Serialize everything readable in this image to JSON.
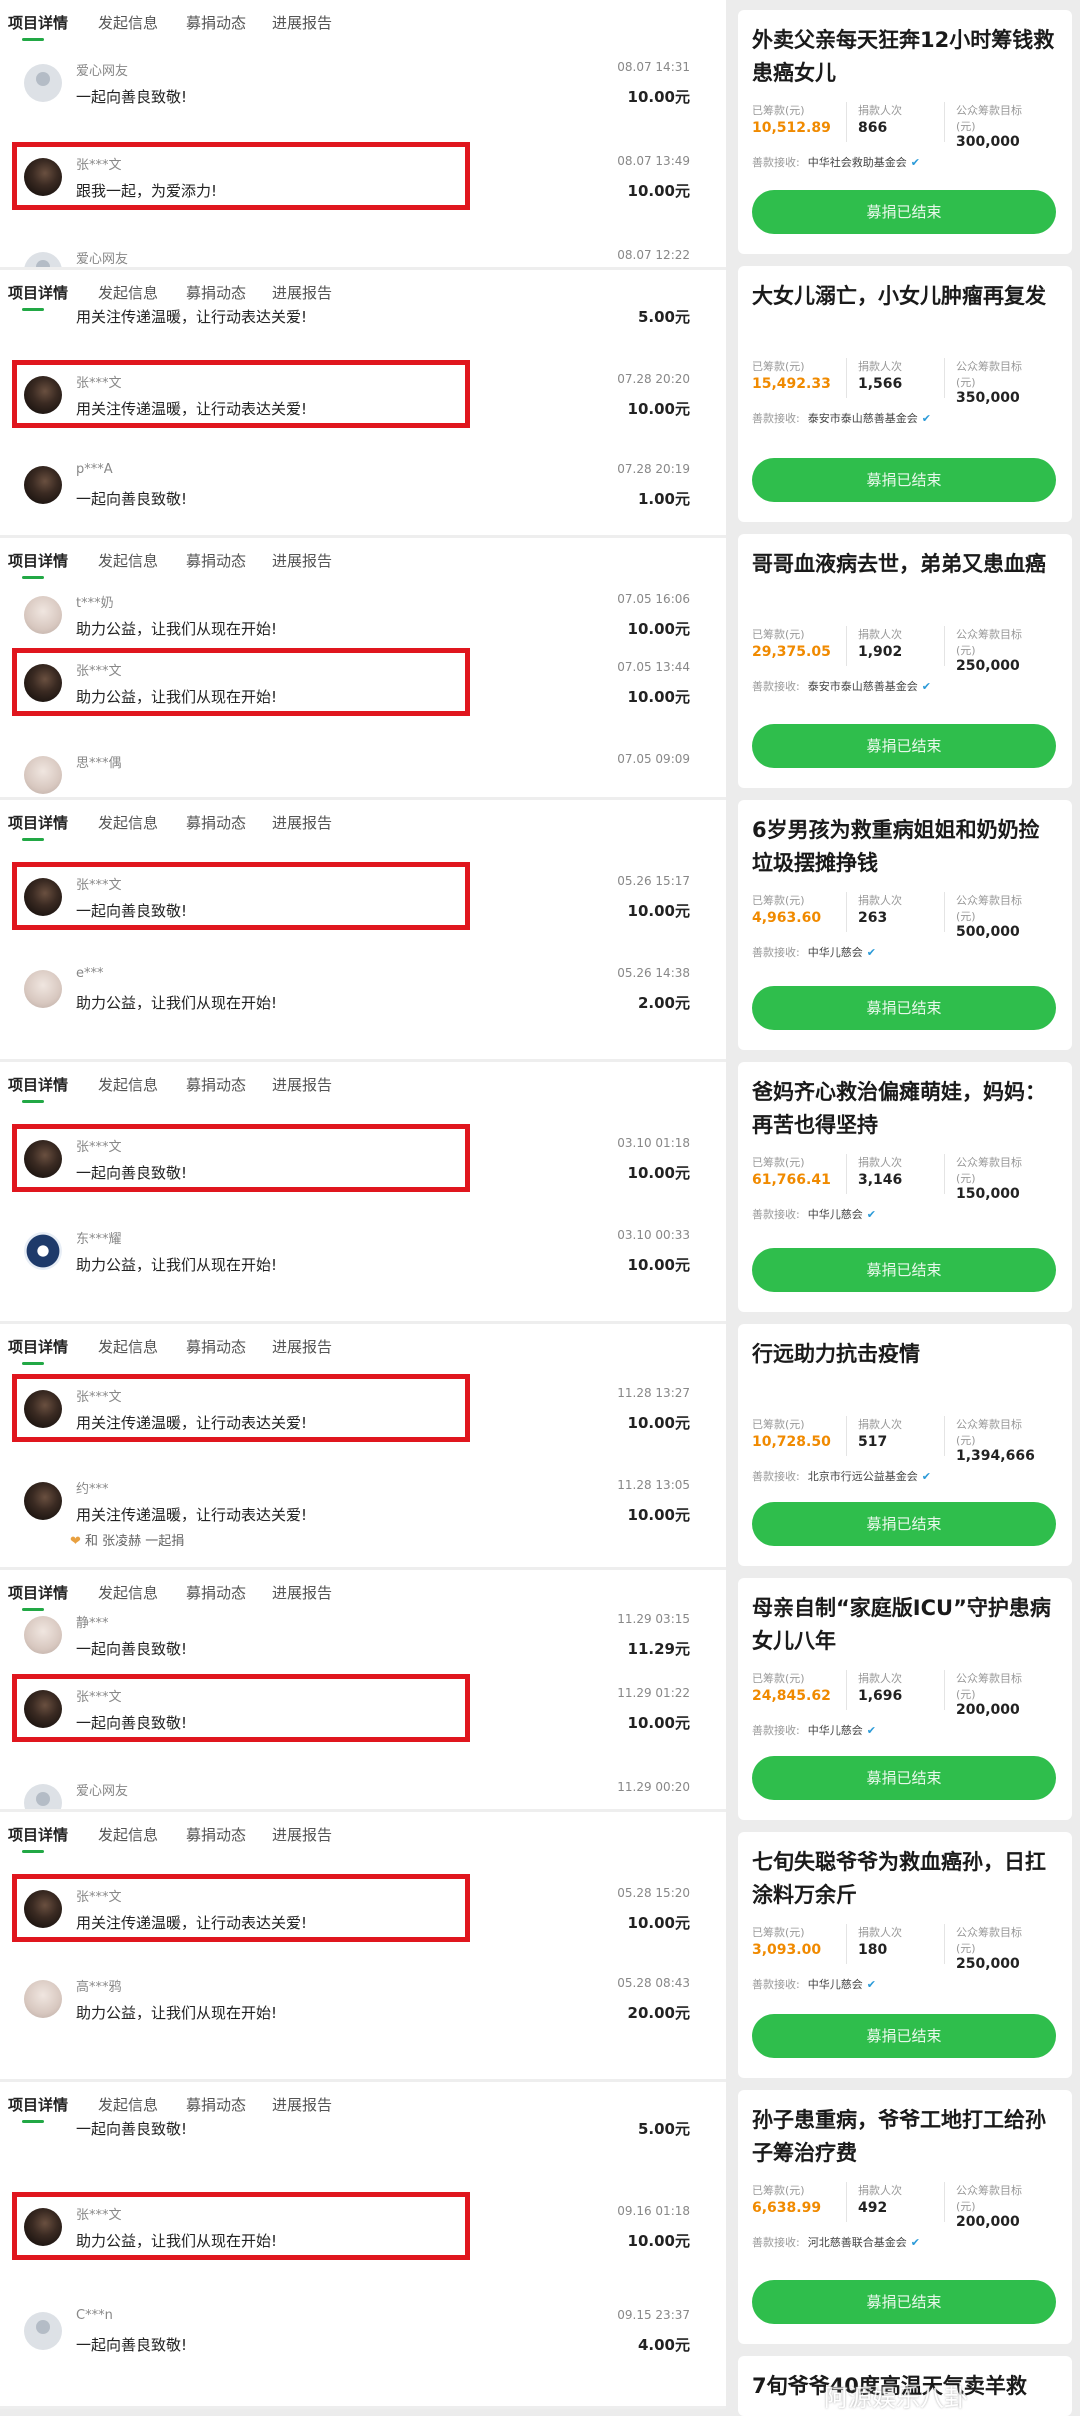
{
  "tab_labels": [
    "项目详情",
    "发起信息",
    "募捐动态",
    "进展报告"
  ],
  "screenshots": [
    {
      "rows": [
        {
          "name": "爱心网友",
          "time": "08.07 14:31",
          "msg": "一起向善良致敬!",
          "amt": "10.00元",
          "avatar": "ghost"
        },
        {
          "name": "张***文",
          "time": "08.07 13:49",
          "msg": "跟我一起，为爱添力!",
          "amt": "10.00元",
          "avatar": "dark",
          "boxed": true
        },
        {
          "name": "爱心网友",
          "time": "08.07 12:22",
          "msg": "",
          "amt": "",
          "avatar": "ghost",
          "partial": true
        }
      ]
    },
    {
      "rows": [
        {
          "name": "",
          "time": "",
          "msg": "用关注传递温暖，让行动表达关爱!",
          "amt": "5.00元",
          "avatar": "none",
          "partial_top": true
        },
        {
          "name": "张***文",
          "time": "07.28 20:20",
          "msg": "用关注传递温暖，让行动表达关爱!",
          "amt": "10.00元",
          "avatar": "dark",
          "boxed": true
        },
        {
          "name": "p***A",
          "time": "07.28 20:19",
          "msg": "一起向善良致敬!",
          "amt": "1.00元",
          "avatar": "dark"
        }
      ]
    },
    {
      "rows": [
        {
          "name": "t***奶",
          "time": "07.05 16:06",
          "msg": "助力公益，让我们从现在开始!",
          "amt": "10.00元",
          "avatar": "light"
        },
        {
          "name": "张***文",
          "time": "07.05 13:44",
          "msg": "助力公益，让我们从现在开始!",
          "amt": "10.00元",
          "avatar": "dark",
          "boxed": true
        },
        {
          "name": "思***偶",
          "time": "07.05 09:09",
          "msg": "",
          "amt": "",
          "avatar": "light",
          "partial": true
        }
      ]
    },
    {
      "rows": [
        {
          "name": "张***文",
          "time": "05.26 15:17",
          "msg": "一起向善良致敬!",
          "amt": "10.00元",
          "avatar": "dark",
          "boxed": true
        },
        {
          "name": "e***",
          "time": "05.26 14:38",
          "msg": "助力公益，让我们从现在开始!",
          "amt": "2.00元",
          "avatar": "light"
        }
      ]
    },
    {
      "rows": [
        {
          "name": "张***文",
          "time": "03.10 01:18",
          "msg": "一起向善良致敬!",
          "amt": "10.00元",
          "avatar": "dark",
          "boxed": true
        },
        {
          "name": "东***耀",
          "time": "03.10 00:33",
          "msg": "助力公益，让我们从现在开始!",
          "amt": "10.00元",
          "avatar": "yin"
        }
      ]
    },
    {
      "rows": [
        {
          "name": "张***文",
          "time": "11.28 13:27",
          "msg": "用关注传递温暖，让行动表达关爱!",
          "amt": "10.00元",
          "avatar": "dark",
          "boxed": true
        },
        {
          "name": "约***",
          "time": "11.28 13:05",
          "msg": "用关注传递温暖，让行动表达关爱!",
          "amt": "10.00元",
          "avatar": "dark",
          "like": "和  张凌赫  一起捐"
        }
      ]
    },
    {
      "rows": [
        {
          "name": "静***",
          "time": "11.29 03:15",
          "msg": "一起向善良致敬!",
          "amt": "11.29元",
          "avatar": "light"
        },
        {
          "name": "张***文",
          "time": "11.29 01:22",
          "msg": "一起向善良致敬!",
          "amt": "10.00元",
          "avatar": "dark",
          "boxed": true
        },
        {
          "name": "爱心网友",
          "time": "11.29 00:20",
          "msg": "",
          "amt": "",
          "avatar": "ghost",
          "partial": true
        }
      ]
    },
    {
      "rows": [
        {
          "name": "张***文",
          "time": "05.28 15:20",
          "msg": "用关注传递温暖，让行动表达关爱!",
          "amt": "10.00元",
          "avatar": "dark",
          "boxed": true
        },
        {
          "name": "高***鸦",
          "time": "05.28 08:43",
          "msg": "助力公益，让我们从现在开始!",
          "amt": "20.00元",
          "avatar": "light"
        }
      ]
    },
    {
      "rows": [
        {
          "name": "",
          "time": "",
          "msg": "一起向善良致敬!",
          "amt": "5.00元",
          "avatar": "none",
          "partial_top": true
        },
        {
          "name": "张***文",
          "time": "09.16 01:18",
          "msg": "助力公益，让我们从现在开始!",
          "amt": "10.00元",
          "avatar": "dark",
          "boxed": true
        },
        {
          "name": "C***n",
          "time": "09.15 23:37",
          "msg": "一起向善良致敬!",
          "amt": "4.00元",
          "avatar": "ghost"
        }
      ]
    }
  ],
  "cards": [
    {
      "title": "外卖父亲每天狂奔12小时筹钱救患癌女儿",
      "raised_label": "已筹款(元)",
      "raised": "10,512.89",
      "donors_label": "捐款人次",
      "donors": "866",
      "target_label": "公众筹款目标(元)",
      "target": "300,000",
      "recv_label": "善款接收:",
      "recv": "中华社会救助基金会",
      "btn": "募捐已结束"
    },
    {
      "title": "大女儿溺亡，小女儿肿瘤再复发",
      "raised_label": "已筹款(元)",
      "raised": "15,492.33",
      "donors_label": "捐款人次",
      "donors": "1,566",
      "target_label": "公众筹款目标(元)",
      "target": "350,000",
      "recv_label": "善款接收:",
      "recv": "泰安市泰山慈善基金会",
      "btn": "募捐已结束"
    },
    {
      "title": "哥哥血液病去世，弟弟又患血癌",
      "raised_label": "已筹款(元)",
      "raised": "29,375.05",
      "donors_label": "捐款人次",
      "donors": "1,902",
      "target_label": "公众筹款目标(元)",
      "target": "250,000",
      "recv_label": "善款接收:",
      "recv": "泰安市泰山慈善基金会",
      "btn": "募捐已结束"
    },
    {
      "title": "6岁男孩为救重病姐姐和奶奶捡垃圾摆摊挣钱",
      "raised_label": "已筹款(元)",
      "raised": "4,963.60",
      "donors_label": "捐款人次",
      "donors": "263",
      "target_label": "公众筹款目标(元)",
      "target": "500,000",
      "recv_label": "善款接收:",
      "recv": "中华儿慈会",
      "btn": "募捐已结束"
    },
    {
      "title": "爸妈齐心救治偏瘫萌娃，妈妈：再苦也得坚持",
      "raised_label": "已筹款(元)",
      "raised": "61,766.41",
      "donors_label": "捐款人次",
      "donors": "3,146",
      "target_label": "公众筹款目标(元)",
      "target": "150,000",
      "recv_label": "善款接收:",
      "recv": "中华儿慈会",
      "btn": "募捐已结束"
    },
    {
      "title": "行远助力抗击疫情",
      "raised_label": "已筹款(元)",
      "raised": "10,728.50",
      "donors_label": "捐款人次",
      "donors": "517",
      "target_label": "公众筹款目标(元)",
      "target": "1,394,666",
      "recv_label": "善款接收:",
      "recv": "北京市行远公益基金会",
      "btn": "募捐已结束"
    },
    {
      "title": "母亲自制“家庭版ICU”守护患病女儿八年",
      "raised_label": "已筹款(元)",
      "raised": "24,845.62",
      "donors_label": "捐款人次",
      "donors": "1,696",
      "target_label": "公众筹款目标(元)",
      "target": "200,000",
      "recv_label": "善款接收:",
      "recv": "中华儿慈会",
      "btn": "募捐已结束"
    },
    {
      "title": "七旬失聪爷爷为救血癌孙，日扛涂料万余斤",
      "raised_label": "已筹款(元)",
      "raised": "3,093.00",
      "donors_label": "捐款人次",
      "donors": "180",
      "target_label": "公众筹款目标(元)",
      "target": "250,000",
      "recv_label": "善款接收:",
      "recv": "中华儿慈会",
      "btn": "募捐已结束"
    },
    {
      "title": "孙子患重病，爷爷工地打工给孙子筹治疗费",
      "raised_label": "已筹款(元)",
      "raised": "6,638.99",
      "donors_label": "捐款人次",
      "donors": "492",
      "target_label": "公众筹款目标(元)",
      "target": "200,000",
      "recv_label": "善款接收:",
      "recv": "河北慈善联合基金会",
      "btn": "募捐已结束"
    },
    {
      "title": "7旬爷爷40度高温天气卖羊救",
      "partial": true
    }
  ],
  "watermark": "阿源娱乐八卦"
}
